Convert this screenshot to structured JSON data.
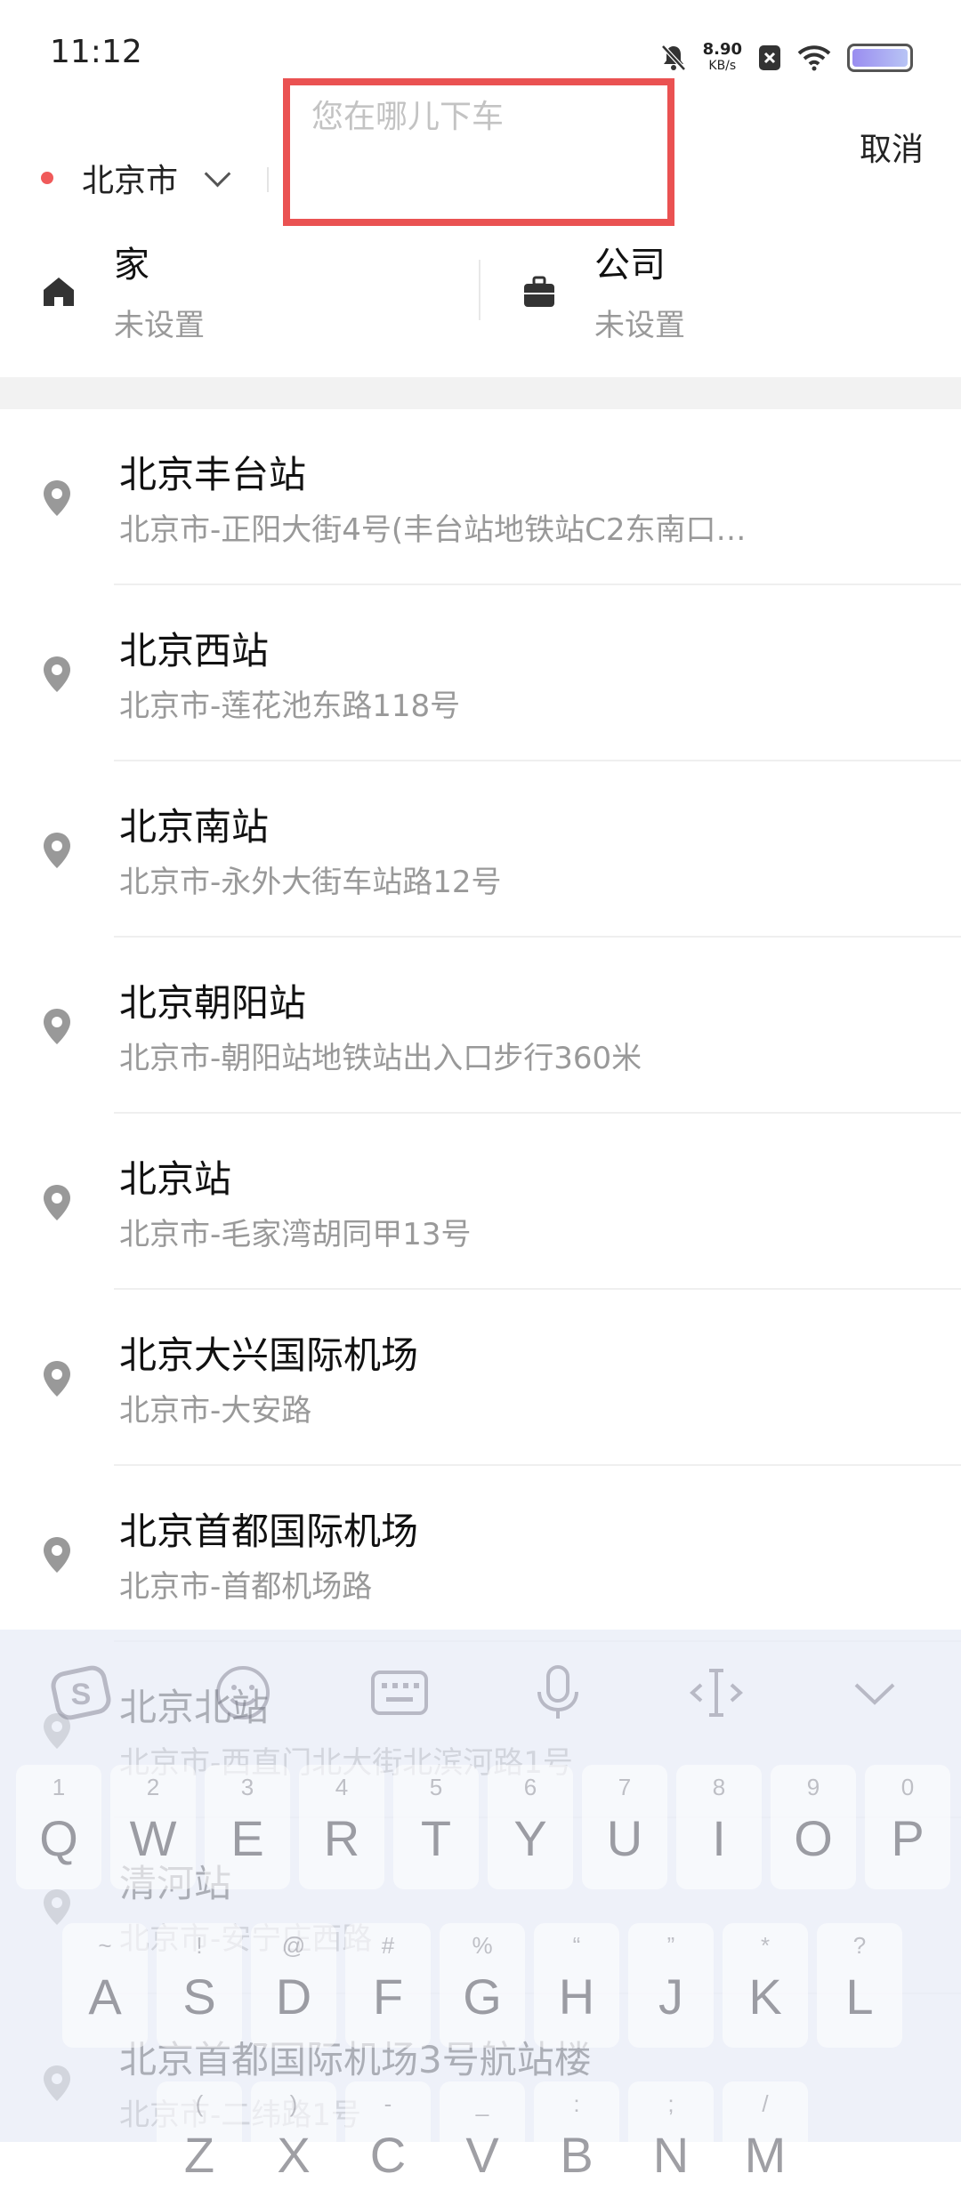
{
  "status_bar": {
    "time": "11:12",
    "speed_value": "8.90",
    "speed_unit": "KB/s"
  },
  "search": {
    "city": "北京市",
    "placeholder": "您在哪儿下车",
    "cancel_label": "取消"
  },
  "shortcuts": {
    "home": {
      "title": "家",
      "subtitle": "未设置"
    },
    "company": {
      "title": "公司",
      "subtitle": "未设置"
    }
  },
  "places": [
    {
      "name": "北京丰台站",
      "address": "北京市-正阳大街4号(丰台站地铁站C2东南口…"
    },
    {
      "name": "北京西站",
      "address": "北京市-莲花池东路118号"
    },
    {
      "name": "北京南站",
      "address": "北京市-永外大街车站路12号"
    },
    {
      "name": "北京朝阳站",
      "address": "北京市-朝阳站地铁站出入口步行360米"
    },
    {
      "name": "北京站",
      "address": "北京市-毛家湾胡同甲13号"
    },
    {
      "name": "北京大兴国际机场",
      "address": "北京市-大安路"
    },
    {
      "name": "北京首都国际机场",
      "address": "北京市-首都机场路"
    },
    {
      "name": "北京北站",
      "address": "北京市-西直门北大街北滨河路1号"
    },
    {
      "name": "清河站",
      "address": "北京市-安宁庄西路"
    },
    {
      "name": "北京首都国际机场3号航站楼",
      "address": "北京市-二纬路1号"
    }
  ],
  "keyboard": {
    "row1": [
      {
        "num": "1",
        "ch": "Q"
      },
      {
        "num": "2",
        "ch": "W"
      },
      {
        "num": "3",
        "ch": "E"
      },
      {
        "num": "4",
        "ch": "R"
      },
      {
        "num": "5",
        "ch": "T"
      },
      {
        "num": "6",
        "ch": "Y"
      },
      {
        "num": "7",
        "ch": "U"
      },
      {
        "num": "8",
        "ch": "I"
      },
      {
        "num": "9",
        "ch": "O"
      },
      {
        "num": "0",
        "ch": "P"
      }
    ],
    "row2": [
      {
        "num": "~",
        "ch": "A"
      },
      {
        "num": "!",
        "ch": "S"
      },
      {
        "num": "@",
        "ch": "D"
      },
      {
        "num": "#",
        "ch": "F"
      },
      {
        "num": "%",
        "ch": "G"
      },
      {
        "num": "“",
        "ch": "H"
      },
      {
        "num": "”",
        "ch": "J"
      },
      {
        "num": "*",
        "ch": "K"
      },
      {
        "num": "?",
        "ch": "L"
      }
    ],
    "row3": [
      {
        "num": "(",
        "ch": "Z"
      },
      {
        "num": ")",
        "ch": "X"
      },
      {
        "num": "-",
        "ch": "C"
      },
      {
        "num": "_",
        "ch": "V"
      },
      {
        "num": ":",
        "ch": "B"
      },
      {
        "num": ";",
        "ch": "N"
      },
      {
        "num": "/",
        "ch": "M"
      }
    ]
  },
  "colors": {
    "accent_red": "#ea5252",
    "city_dot": "#f05a5a",
    "secondary_text": "#999999"
  }
}
